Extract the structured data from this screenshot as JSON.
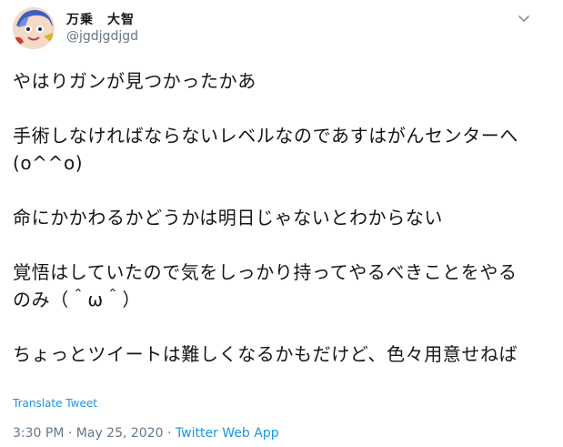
{
  "tweet": {
    "display_name": "万乗　大智",
    "handle": "@jgdjgdjgd",
    "text": "やはりガンが見つかったかあ\n\n手術しなければならないレベルなのであすはがんセンターへ(o^^o)\n\n命にかかわるかどうかは明日じゃないとわからない\n\n覚悟はしていたので気をしっかり持ってやるべきことをやるのみ（＾ω＾）\n\nちょっとツイートは難しくなるかもだけど、色々用意せねば",
    "translate_label": "Translate Tweet",
    "time": "3:30 PM",
    "separator": "·",
    "date": "May 25, 2020",
    "source": "Twitter Web App"
  },
  "icons": {
    "menu": "chevron-down-icon",
    "avatar": "avatar"
  },
  "colors": {
    "link": "#1b95e0",
    "muted": "#657786",
    "text": "#14171a"
  }
}
